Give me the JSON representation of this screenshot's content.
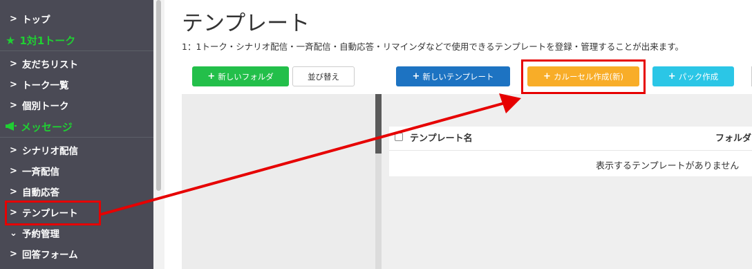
{
  "sidebar": {
    "items": [
      {
        "label": "トップ",
        "icon": "chevron-right-icon"
      },
      {
        "label": "1対1トーク",
        "icon": "star-icon",
        "section": true
      },
      {
        "label": "友だちリスト",
        "icon": "chevron-right-icon"
      },
      {
        "label": "トーク一覧",
        "icon": "chevron-right-icon"
      },
      {
        "label": "個別トーク",
        "icon": "chevron-right-icon"
      },
      {
        "label": "メッセージ",
        "icon": "megaphone-icon",
        "section": true
      },
      {
        "label": "シナリオ配信",
        "icon": "chevron-right-icon"
      },
      {
        "label": "一斉配信",
        "icon": "chevron-right-icon"
      },
      {
        "label": "自動応答",
        "icon": "chevron-right-icon"
      },
      {
        "label": "テンプレート",
        "icon": "chevron-right-icon"
      },
      {
        "label": "予約管理",
        "icon": "chevron-down-icon"
      },
      {
        "label": "回答フォーム",
        "icon": "chevron-right-icon"
      }
    ]
  },
  "page": {
    "title": "テンプレート",
    "description": "1：1トーク・シナリオ配信・一斉配信・自動応答・リマインダなどで使用できるテンプレートを登録・管理することが出来ます。"
  },
  "toolbar": {
    "new_folder": "新しいフォルダ",
    "sort": "並び替え",
    "new_template": "新しいテンプレート",
    "carousel": "カルーセル作成(新)",
    "pack": "パック作成"
  },
  "table": {
    "col_name": "テンプレート名",
    "col_folder": "フォルダ",
    "empty": "表示するテンプレートがありません"
  },
  "colors": {
    "sidebar_bg": "#4a4a55",
    "section_green": "#20cf33",
    "highlight_red": "#e60000"
  }
}
